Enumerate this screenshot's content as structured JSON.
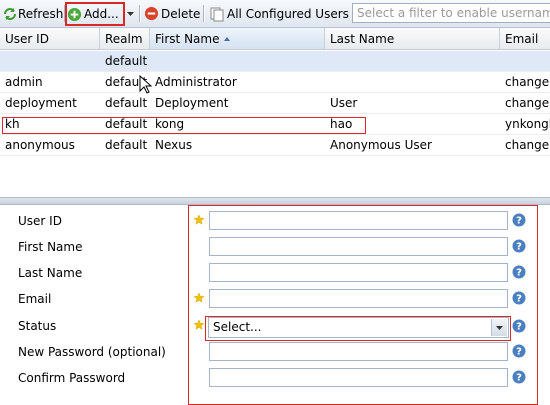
{
  "toolbar": {
    "refresh_label": "Refresh",
    "add_label": "Add...",
    "delete_label": "Delete",
    "filter_menu_label": "All Configured Users",
    "filter_placeholder": "Select a filter to enable username s"
  },
  "grid": {
    "columns": [
      "User ID",
      "Realm",
      "First Name",
      "Last Name",
      "Email"
    ],
    "sorted_column": "First Name",
    "sort_direction": "ascending",
    "rows": [
      {
        "user_id": "",
        "realm": "default",
        "first_name": "",
        "last_name": "",
        "email": ""
      },
      {
        "user_id": "admin",
        "realm": "default",
        "first_name": "Administrator",
        "last_name": "",
        "email": "changeme"
      },
      {
        "user_id": "deployment",
        "realm": "default",
        "first_name": "Deployment",
        "last_name": "User",
        "email": "changeme"
      },
      {
        "user_id": "kh",
        "realm": "default",
        "first_name": "kong",
        "last_name": "hao",
        "email": "ynkongh"
      },
      {
        "user_id": "anonymous",
        "realm": "default",
        "first_name": "Nexus",
        "last_name": "Anonymous User",
        "email": "changeme"
      }
    ]
  },
  "form": {
    "user_id_label": "User ID",
    "first_name_label": "First Name",
    "last_name_label": "Last Name",
    "email_label": "Email",
    "status_label": "Status",
    "status_value": "Select...",
    "new_password_label": "New Password (optional)",
    "confirm_password_label": "Confirm Password"
  },
  "colors": {
    "highlight": "#d42a2a",
    "selected_row": "#dfe8f6",
    "help_icon": "#4a7fc0",
    "required_star": "#f2c200"
  }
}
